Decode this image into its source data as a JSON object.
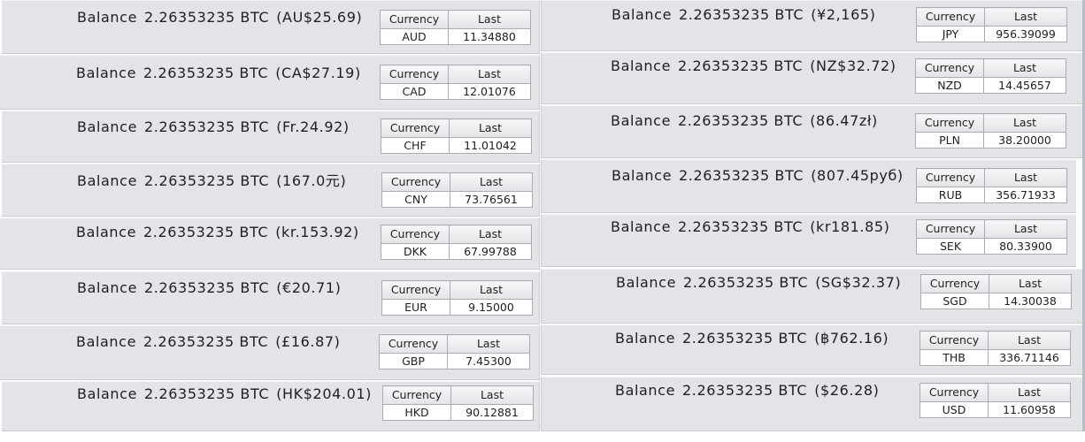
{
  "labels": {
    "balance": "Balance",
    "col_currency": "Currency",
    "col_last": "Last"
  },
  "left": [
    {
      "amount": "2.26353235 BTC",
      "converted": "(AU$25.69)",
      "currency": "AUD",
      "last": "11.34880"
    },
    {
      "amount": "2.26353235 BTC",
      "converted": "(CA$27.19)",
      "currency": "CAD",
      "last": "12.01076"
    },
    {
      "amount": "2.26353235 BTC",
      "converted": "(Fr.24.92)",
      "currency": "CHF",
      "last": "11.01042"
    },
    {
      "amount": "2.26353235 BTC",
      "converted": "(167.0元)",
      "currency": "CNY",
      "last": "73.76561"
    },
    {
      "amount": "2.26353235 BTC",
      "converted": "(kr.153.92)",
      "currency": "DKK",
      "last": "67.99788"
    },
    {
      "amount": "2.26353235 BTC",
      "converted": "(€20.71)",
      "currency": "EUR",
      "last": "9.15000"
    },
    {
      "amount": "2.26353235 BTC",
      "converted": "(£16.87)",
      "currency": "GBP",
      "last": "7.45300"
    },
    {
      "amount": "2.26353235 BTC",
      "converted": "(HK$204.01)",
      "currency": "HKD",
      "last": "90.12881"
    }
  ],
  "right": [
    {
      "amount": "2.26353235 BTC",
      "converted": "(¥2,165)",
      "currency": "JPY",
      "last": "956.39099"
    },
    {
      "amount": "2.26353235 BTC",
      "converted": "(NZ$32.72)",
      "currency": "NZD",
      "last": "14.45657"
    },
    {
      "amount": "2.26353235 BTC",
      "converted": "(86.47zł)",
      "currency": "PLN",
      "last": "38.20000"
    },
    {
      "amount": "2.26353235 BTC",
      "converted": "(807.45руб)",
      "currency": "RUB",
      "last": "356.71933"
    },
    {
      "amount": "2.26353235 BTC",
      "converted": "(kr181.85)",
      "currency": "SEK",
      "last": "80.33900"
    },
    {
      "amount": "2.26353235 BTC",
      "converted": "(SG$32.37)",
      "currency": "SGD",
      "last": "14.30038"
    },
    {
      "amount": "2.26353235 BTC",
      "converted": "(฿762.16)",
      "currency": "THB",
      "last": "336.71146"
    },
    {
      "amount": "2.26353235 BTC",
      "converted": "($26.28)",
      "currency": "USD",
      "last": "11.60958"
    }
  ]
}
